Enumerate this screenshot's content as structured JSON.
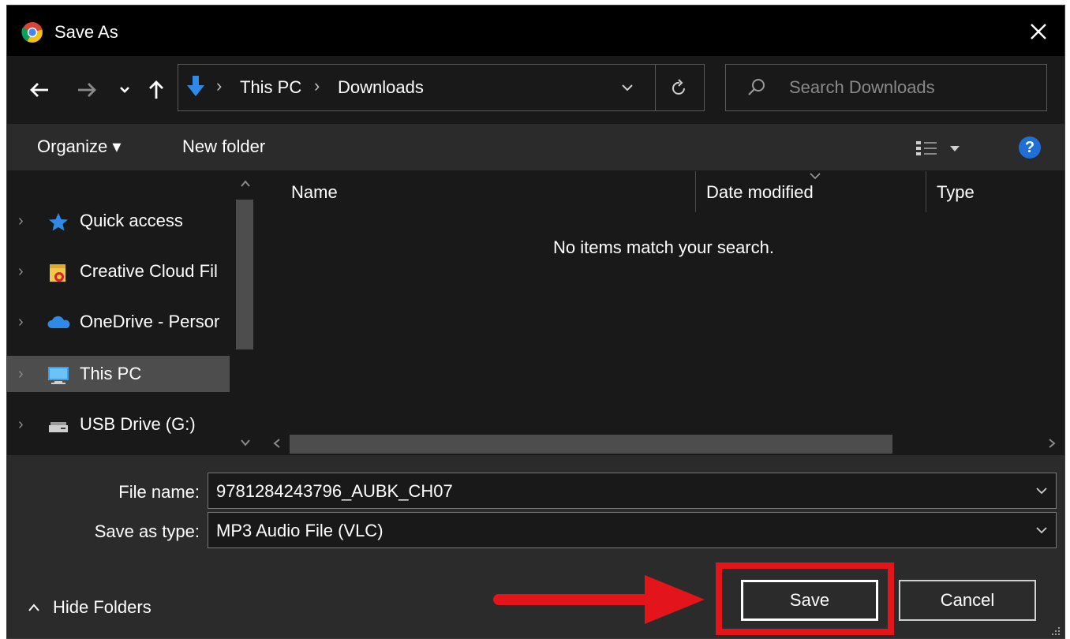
{
  "window": {
    "title": "Save As",
    "app_icon": "chrome-icon",
    "close_icon": "close-icon"
  },
  "nav": {
    "back_icon": "back-arrow-icon",
    "forward_icon": "forward-arrow-icon",
    "recent_icon": "chevron-down-icon",
    "up_icon": "up-arrow-icon",
    "breadcrumb": [
      "This PC",
      "Downloads"
    ],
    "separator": "›",
    "refresh_icon": "refresh-icon",
    "search_placeholder": "Search Downloads"
  },
  "toolbar": {
    "organize_label": "Organize ▾",
    "new_folder_label": "New folder",
    "view_icon": "details-view-icon",
    "help_label": "?"
  },
  "sidebar": {
    "items": [
      {
        "label": "Quick access",
        "icon": "star-icon"
      },
      {
        "label": "Creative Cloud Fil",
        "icon": "creative-cloud-folder-icon"
      },
      {
        "label": "OneDrive - Persor",
        "icon": "onedrive-cloud-icon"
      },
      {
        "label": "This PC",
        "icon": "computer-icon",
        "selected": true
      },
      {
        "label": "USB Drive (G:)",
        "icon": "usb-drive-icon"
      }
    ]
  },
  "filelist": {
    "columns": [
      "Name",
      "Date modified",
      "Type"
    ],
    "empty_message": "No items match your search."
  },
  "form": {
    "file_name_label": "File name:",
    "file_name_value": "9781284243796_AUBK_CH07",
    "save_type_label": "Save as type:",
    "save_type_value": "MP3 Audio File (VLC)"
  },
  "footer": {
    "hide_folders_label": "Hide Folders",
    "save_label": "Save",
    "cancel_label": "Cancel"
  },
  "colors": {
    "background": "#191919",
    "panel": "#2b2b2b",
    "highlight": "#e3151a",
    "accent": "#1f6fd6"
  }
}
